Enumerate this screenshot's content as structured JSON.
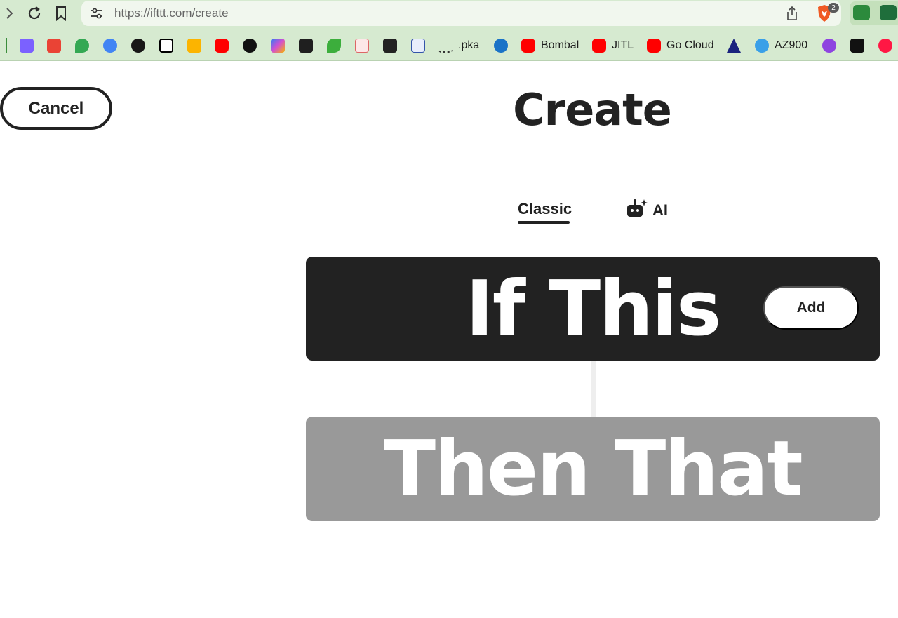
{
  "browser": {
    "url_host": "https://ifttt.com",
    "url_path": "/create",
    "brave_badge": "2",
    "bookmarks": [
      {
        "label": ".pka",
        "icon": "cisco-icon"
      },
      {
        "label": "Bombal",
        "icon": "youtube-icon"
      },
      {
        "label": "JITL",
        "icon": "youtube-icon"
      },
      {
        "label": "Go Cloud",
        "icon": "youtube-icon"
      },
      {
        "label": "AZ900",
        "icon": "cloud-icon"
      }
    ]
  },
  "page": {
    "cancel_label": "Cancel",
    "title": "Create",
    "tabs": {
      "classic": "Classic",
      "ai": "AI"
    },
    "if_label": "If This",
    "add_label": "Add",
    "then_label": "Then That"
  },
  "colors": {
    "if_box": "#222222",
    "then_box": "#999999",
    "chrome": "#d6ead0"
  }
}
